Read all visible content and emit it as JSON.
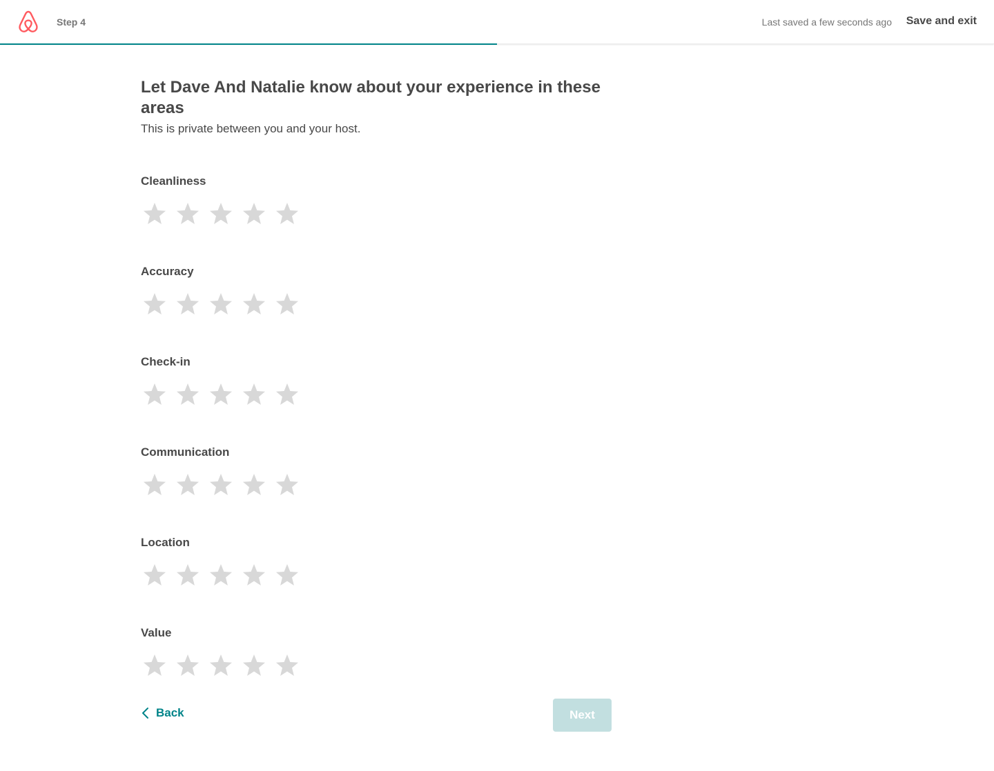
{
  "header": {
    "step_label": "Step 4",
    "saved_status": "Last saved a few seconds ago",
    "save_exit_label": "Save and exit",
    "progress": 0.5,
    "brand_color": "#FF5A5F",
    "accent_color": "#008489",
    "logo_icon": "airbnb-logo-icon"
  },
  "main": {
    "title": "Let Dave And Natalie know about your experience in these areas",
    "subtitle": "This is private between you and your host."
  },
  "categories": [
    {
      "label": "Cleanliness",
      "rating": 0,
      "max": 5
    },
    {
      "label": "Accuracy",
      "rating": 0,
      "max": 5
    },
    {
      "label": "Check-in",
      "rating": 0,
      "max": 5
    },
    {
      "label": "Communication",
      "rating": 0,
      "max": 5
    },
    {
      "label": "Location",
      "rating": 0,
      "max": 5
    },
    {
      "label": "Value",
      "rating": 0,
      "max": 5
    }
  ],
  "star_empty_color": "#D8D8D8",
  "footer": {
    "back_label": "Back",
    "next_label": "Next",
    "next_disabled": true
  }
}
